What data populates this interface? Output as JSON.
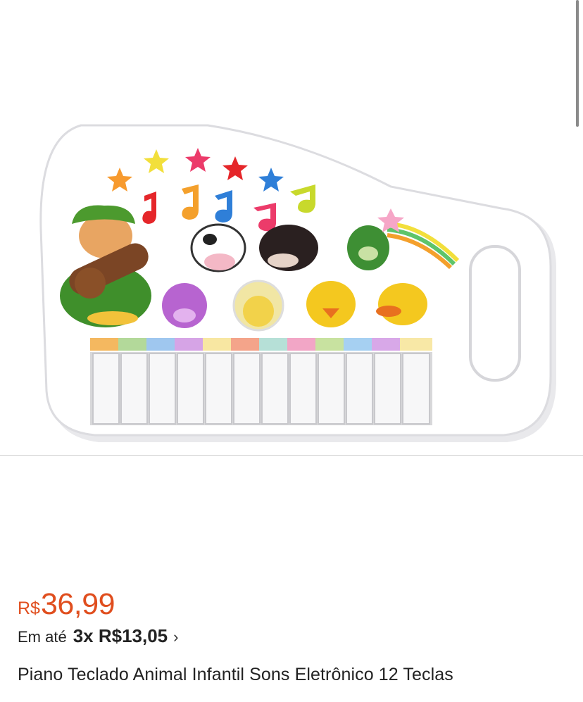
{
  "product": {
    "image_alt": "Piano Teclado Animal Infantil",
    "price_currency": "R$",
    "price_value": "36,99",
    "installments_prefix": "Em até",
    "installments_detail": "3x R$13,05",
    "installments_chevron": "›",
    "title": "Piano Teclado Animal Infantil Sons Eletrônico 12 Teclas"
  },
  "colors": {
    "price": "#e04e1e",
    "text": "#222222",
    "divider": "#cfcfcf"
  }
}
